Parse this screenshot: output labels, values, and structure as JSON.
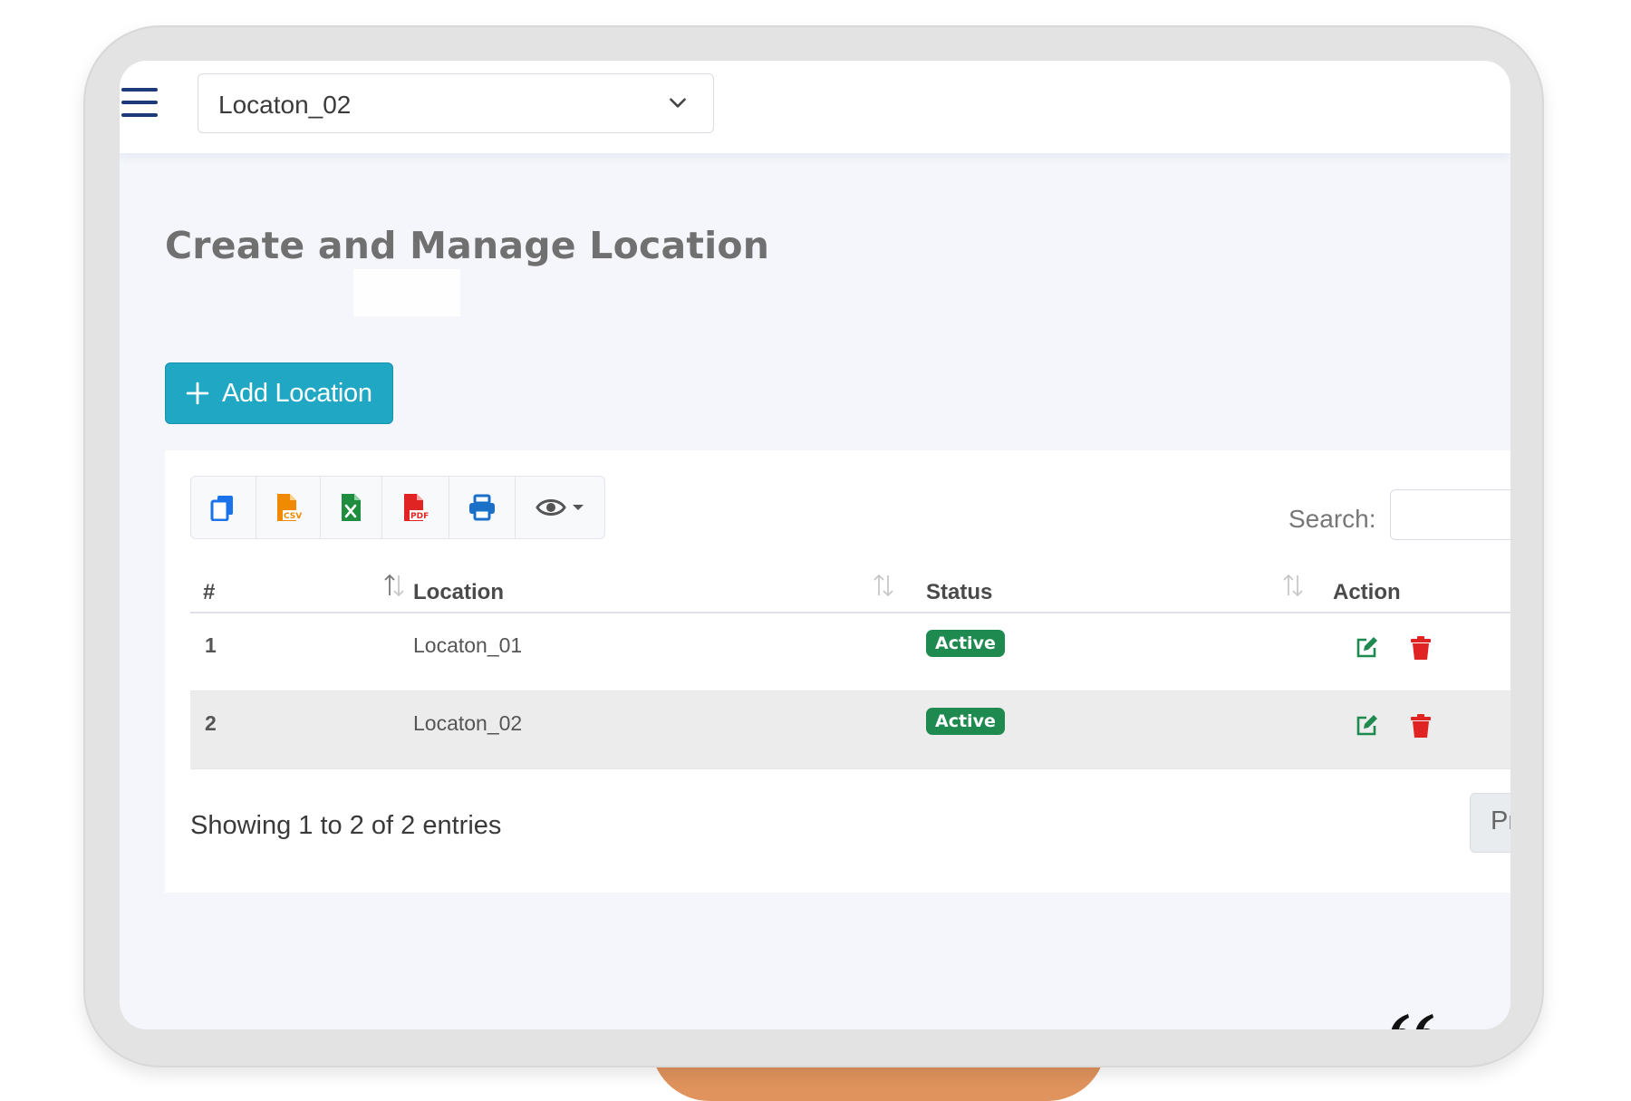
{
  "header": {
    "menu_icon": "hamburger-menu-icon",
    "location_select": {
      "value": "Locaton_02",
      "icon": "chevron-down-icon"
    }
  },
  "page": {
    "title": "Create and Manage Location",
    "add_button_label": "Add Location"
  },
  "toolbar": {
    "buttons": [
      {
        "name": "copy",
        "icon": "copy-icon",
        "color": "#1a73e8"
      },
      {
        "name": "csv",
        "icon": "csv-file-icon",
        "color": "#f08a00"
      },
      {
        "name": "excel",
        "icon": "excel-file-icon",
        "color": "#1e8e3e"
      },
      {
        "name": "pdf",
        "icon": "pdf-file-icon",
        "color": "#e02424"
      },
      {
        "name": "print",
        "icon": "print-icon",
        "color": "#1a6fc7"
      },
      {
        "name": "column-visibility",
        "icon": "eye-icon",
        "color": "#555555"
      }
    ]
  },
  "search": {
    "label": "Search:",
    "value": ""
  },
  "table": {
    "columns": [
      "#",
      "Location",
      "Status",
      "Action"
    ],
    "rows": [
      {
        "num": "1",
        "location": "Locaton_01",
        "status": "Active"
      },
      {
        "num": "2",
        "location": "Locaton_02",
        "status": "Active"
      }
    ]
  },
  "footer": {
    "showing_text": "Showing 1 to 2 of 2 entries",
    "prev_label": "Prev"
  },
  "colors": {
    "accent": "#1fa7c4",
    "status_active": "#1e8a4f",
    "edit_icon": "#1e8a4f",
    "delete_icon": "#e02424",
    "decoration": "#e0935c"
  }
}
